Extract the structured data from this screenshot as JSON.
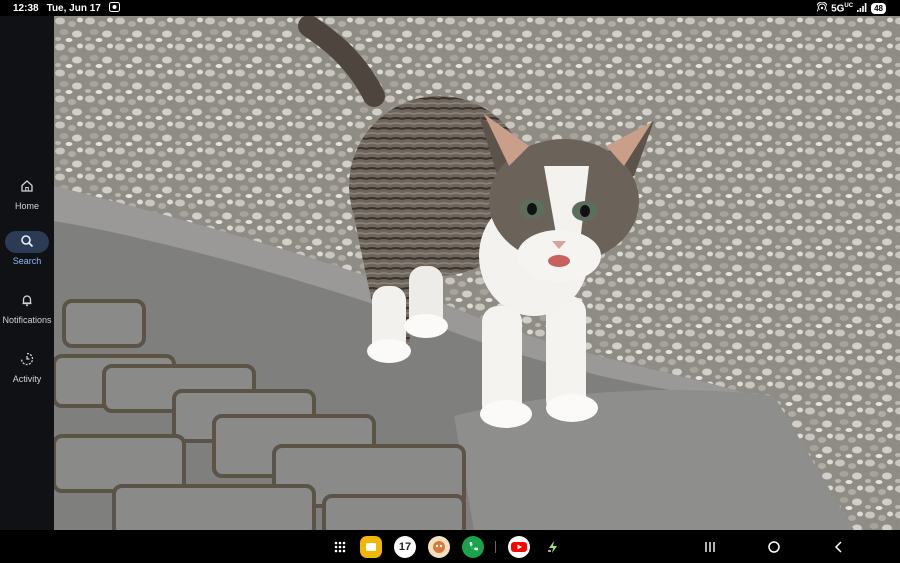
{
  "status_bar": {
    "time": "12:38",
    "date": "Tue, Jun 17",
    "network": "5G",
    "network_sup": "UC",
    "battery": "48"
  },
  "sidebar": {
    "items": [
      {
        "label": "Home",
        "icon": "home-icon"
      },
      {
        "label": "Search",
        "icon": "search-icon",
        "active": true
      },
      {
        "label": "Notifications",
        "icon": "bell-icon"
      },
      {
        "label": "Activity",
        "icon": "activity-icon"
      }
    ]
  },
  "photo": {
    "subject": "kitten-on-gravel-photo"
  },
  "taskbar": {
    "apps": [
      {
        "icon": "app-drawer-icon"
      },
      {
        "icon": "notes-app-icon",
        "color": "#f2b705"
      },
      {
        "icon": "calendar-app-icon",
        "text": "17"
      },
      {
        "icon": "game-app-icon"
      },
      {
        "icon": "phone-app-icon",
        "color": "#1aa34a"
      },
      {
        "icon": "youtube-app-icon",
        "color": "#ff0000"
      },
      {
        "icon": "flash-app-icon"
      }
    ],
    "nav": [
      "recents-icon",
      "home-button-icon",
      "back-icon"
    ]
  }
}
